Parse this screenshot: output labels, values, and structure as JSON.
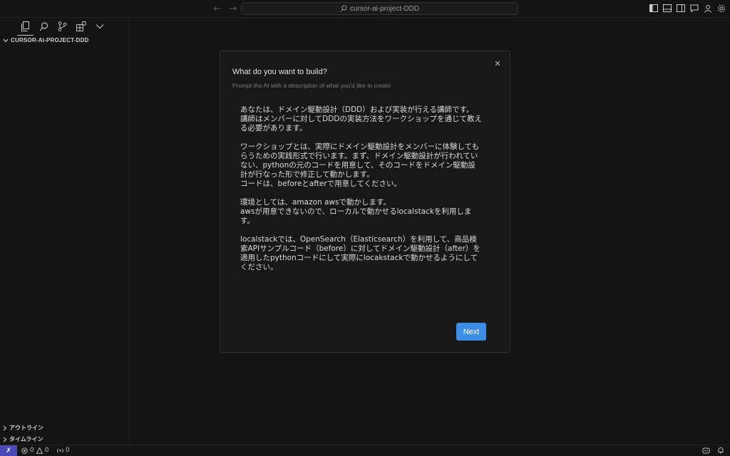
{
  "titlebar": {
    "search_label": "cursor-ai-project-DDD",
    "back_icon": "arrow-left-icon",
    "forward_icon": "arrow-right-icon"
  },
  "sidebar": {
    "activity_icons": [
      "files-icon",
      "search-icon",
      "source-control-icon",
      "extensions-icon",
      "chevron-down-icon"
    ],
    "explorer_title": "CURSOR-AI-PROJECT-DDD",
    "outline_label": "アウトライン",
    "timeline_label": "タイムライン"
  },
  "dialog": {
    "title": "What do you want to build?",
    "subtitle": "Prompt the AI with a description of what you'd like to create",
    "paragraphs": [
      "あなたは、ドメイン駆動設計（DDD）および実装が行える講師です。\n講師はメンバーに対してDDDの実装方法をワークショップを通じて教える必要があります。",
      "ワークショップとは、実際にドメイン駆動設計をメンバーに体験してもらうための実践形式で行います。まず、ドメイン駆動設計が行われていない、pythonの元のコードを用意して、そのコードをドメイン駆動設計が行なった形で修正して動かします。\nコードは、beforeとafterで用意してください。",
      "環境としては、amazon awsで動かします。\nawsが用意できないので、ローカルで動かせるlocalstackを利用します。",
      "localstackでは、OpenSearch（Elasticsearch）を利用して、商品検索APIサンプルコード（before）に対してドメイン駆動設計（after）を適用したpythonコードにして実際にlocakstackで動かせるようにしてください。"
    ],
    "next_label": "Next"
  },
  "statusbar": {
    "errors": "0",
    "warnings": "0",
    "ports": "0"
  },
  "colors": {
    "background": "#141414",
    "accent": "#3b8de6",
    "remote": "#4a49b8"
  }
}
